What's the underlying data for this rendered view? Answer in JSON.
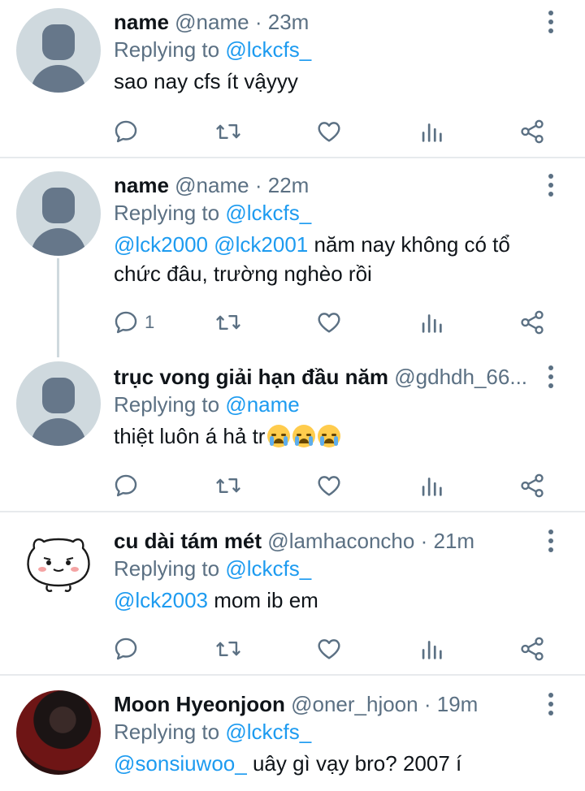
{
  "colors": {
    "accent": "#1d9bf0",
    "secondary_text": "#5b7083",
    "divider": "#e7eaed",
    "icon": "#5b7083"
  },
  "tweets": [
    {
      "display_name": "name",
      "handle": "@name",
      "separator": "·",
      "time": "23m",
      "replying_prefix": "Replying to",
      "replying_to": "@lckcfs_",
      "text": "sao nay cfs ít vậyyy",
      "reply_count": "",
      "avatar": "default-avatar-icon"
    },
    {
      "display_name": "name",
      "handle": "@name",
      "separator": "·",
      "time": "22m",
      "replying_prefix": "Replying to",
      "replying_to": "@lckcfs_",
      "text_mention_1": "@lck2000",
      "text_mention_2": "@lck2001",
      "text": " năm nay không có tổ chức đâu, trường nghèo rồi",
      "reply_count": "1",
      "avatar": "default-avatar-icon"
    },
    {
      "display_name": "trục vong giải hạn đầu năm",
      "handle": "@gdhdh_66...",
      "replying_prefix": "Replying to",
      "replying_to": "@name",
      "text": "thiệt luôn á hả tr",
      "emojis": [
        "loudly-crying-face-icon",
        "loudly-crying-face-icon",
        "loudly-crying-face-icon"
      ],
      "reply_count": "",
      "avatar": "default-avatar-icon"
    },
    {
      "display_name": "cu dài tám mét",
      "handle": "@lamhaconcho",
      "separator": "·",
      "time": "21m",
      "replying_prefix": "Replying to",
      "replying_to": "@lckcfs_",
      "text_mention_1": "@lck2003",
      "text": " mom ib em",
      "reply_count": "",
      "avatar": "hamster-sticker-avatar"
    },
    {
      "display_name": "Moon Hyeonjoon",
      "handle": "@oner_hjoon",
      "separator": "·",
      "time": "19m",
      "replying_prefix": "Replying to",
      "replying_to": "@lckcfs_",
      "text_mention_1": "@sonsiuwoo_",
      "text": " uây gì vạy bro? 2007 í",
      "avatar": "photo-avatar"
    }
  ],
  "action_icons": [
    "reply-icon",
    "retweet-icon",
    "like-icon",
    "analytics-icon",
    "share-icon"
  ]
}
